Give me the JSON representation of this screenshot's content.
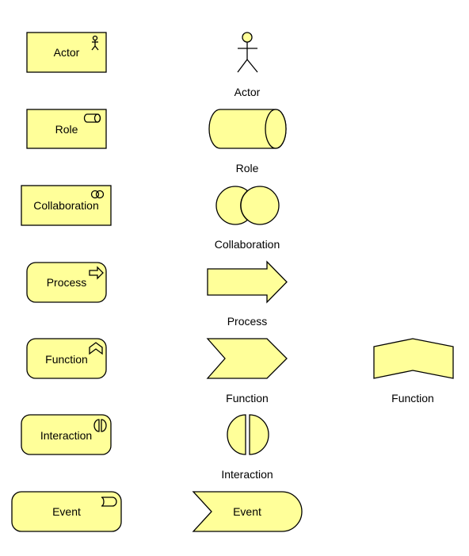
{
  "colors": {
    "fill": "#ffff99",
    "stroke": "#000000"
  },
  "boxes": {
    "actor": "Actor",
    "role": "Role",
    "collaboration": "Collaboration",
    "process": "Process",
    "function": "Function",
    "interaction": "Interaction",
    "event": "Event"
  },
  "shapes": {
    "actor": "Actor",
    "role": "Role",
    "collaboration": "Collaboration",
    "process": "Process",
    "function": "Function",
    "function_alt": "Function",
    "interaction": "Interaction",
    "event": "Event"
  }
}
